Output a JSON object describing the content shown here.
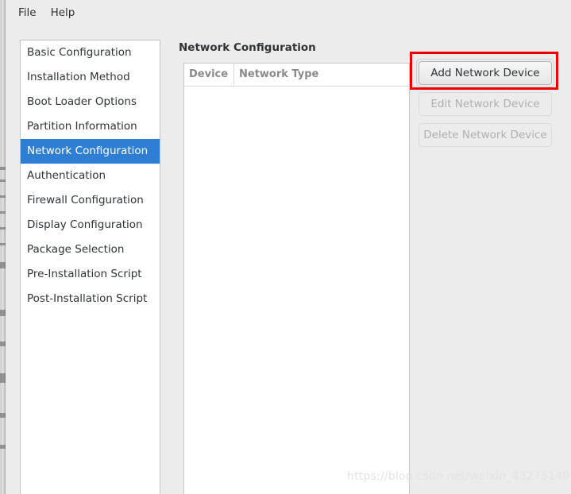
{
  "window": {
    "menubar": [
      {
        "label": "File"
      },
      {
        "label": "Help"
      }
    ]
  },
  "sidebar": {
    "items": [
      {
        "label": "Basic Configuration",
        "selected": false
      },
      {
        "label": "Installation Method",
        "selected": false
      },
      {
        "label": "Boot Loader Options",
        "selected": false
      },
      {
        "label": "Partition Information",
        "selected": false
      },
      {
        "label": "Network Configuration",
        "selected": true
      },
      {
        "label": "Authentication",
        "selected": false
      },
      {
        "label": "Firewall Configuration",
        "selected": false
      },
      {
        "label": "Display Configuration",
        "selected": false
      },
      {
        "label": "Package Selection",
        "selected": false
      },
      {
        "label": "Pre-Installation Script",
        "selected": false
      },
      {
        "label": "Post-Installation Script",
        "selected": false
      }
    ]
  },
  "main": {
    "title": "Network Configuration",
    "table": {
      "columns": [
        "Device",
        "Network Type"
      ],
      "rows": []
    },
    "buttons": [
      {
        "label": "Add Network Device",
        "enabled": true
      },
      {
        "label": "Edit Network Device",
        "enabled": false
      },
      {
        "label": "Delete Network Device",
        "enabled": false
      }
    ]
  },
  "annotation": {
    "highlight_color": "#ee0000"
  },
  "watermark": {
    "text": "https://blog.csdn.net/weixin_43275140"
  },
  "colors": {
    "background": "#ececec",
    "selection": "#2e7fd4",
    "panel": "#ffffff",
    "text": "#2e3436",
    "muted_text": "#8a8a8a"
  }
}
